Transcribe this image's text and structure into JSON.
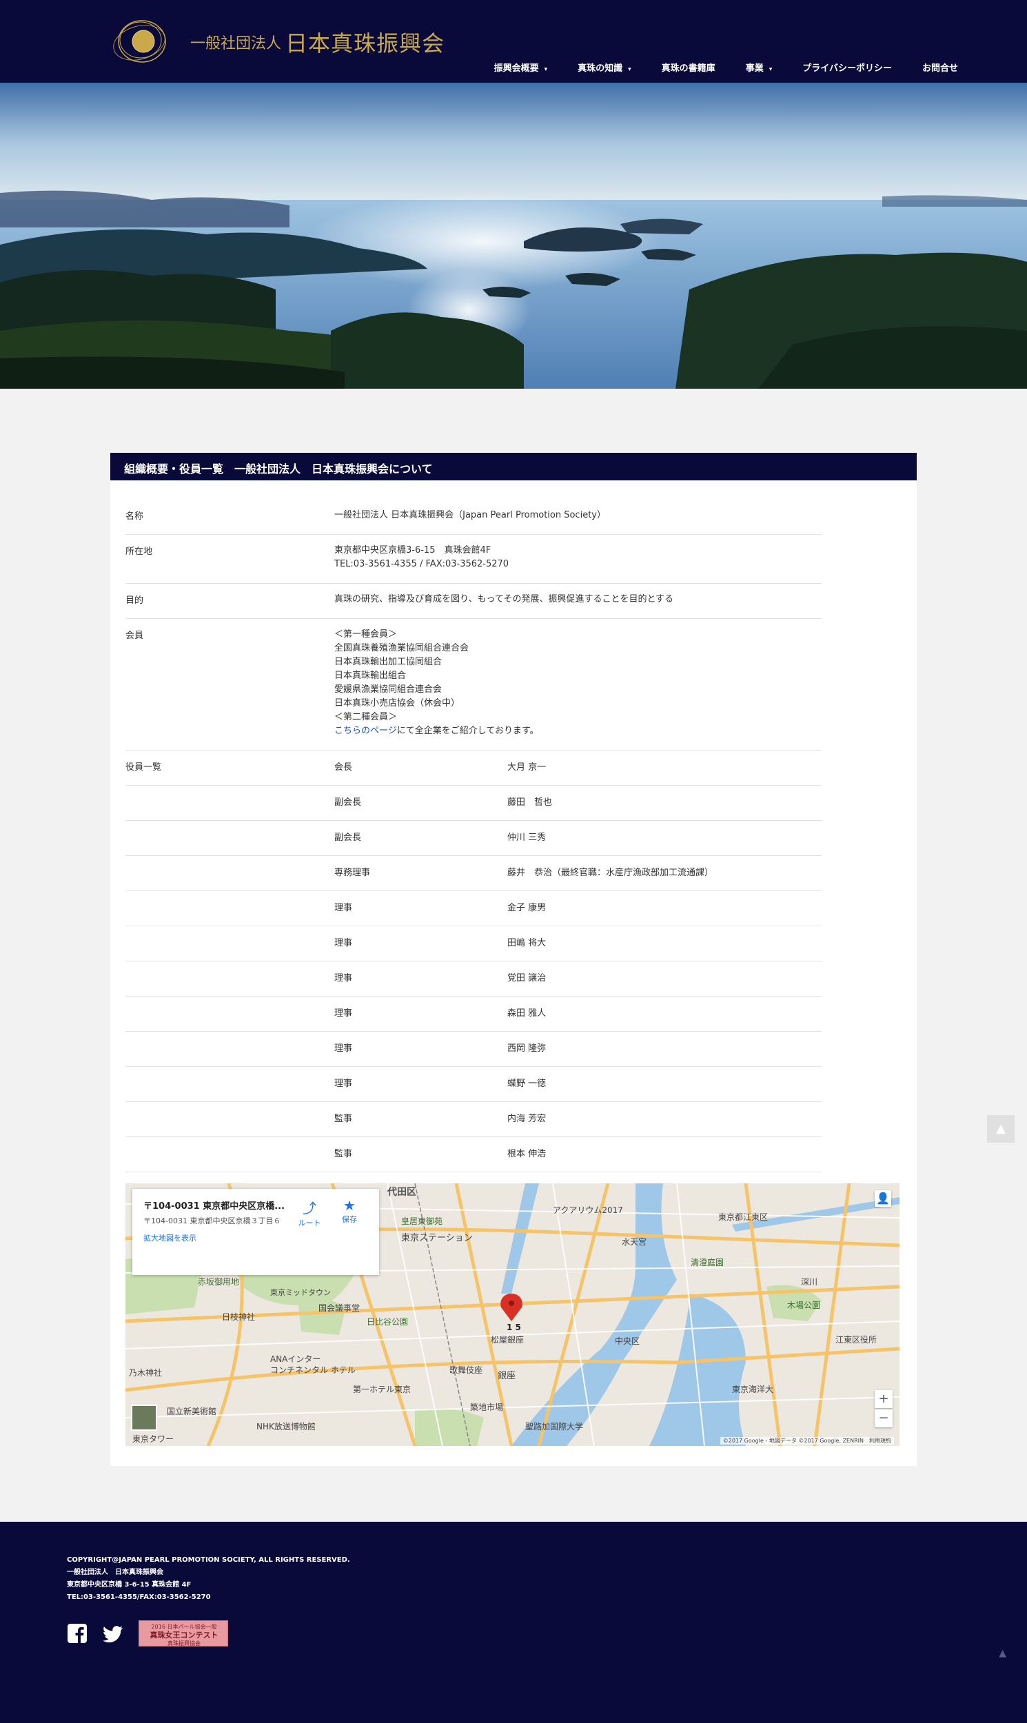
{
  "header": {
    "logo_small": "一般社団法人",
    "logo_big": "日本真珠振興会",
    "nav": [
      {
        "label": "振興会概要"
      },
      {
        "label": "真珠の知識"
      },
      {
        "label": "真珠の書籍庫"
      },
      {
        "label": "事業"
      },
      {
        "label": "プライバシーポリシー"
      },
      {
        "label": "お問合せ"
      }
    ],
    "caret": "▼"
  },
  "section": {
    "title": "組織概要・役員一覧　一般社団法人　日本真珠振興会について"
  },
  "info": {
    "name_label": "名称",
    "name_value": "一般社団法人 日本真珠振興会（Japan Pearl Promotion Society）",
    "address_label": "所在地",
    "address_line1": "東京都中央区京橋3-6-15　真珠会館4F",
    "address_line2": "TEL:03-3561-4355 / FAX:03-3562-5270",
    "purpose_label": "目的",
    "purpose_value": "真珠の研究、指導及び育成を図り、もってその発展、振興促進することを目的とする",
    "members_label": "会員",
    "members": [
      "＜第一種会員＞",
      "全国真珠養殖漁業協同組合連合会",
      "日本真珠輸出加工協同組合",
      "日本真珠輸出組合",
      "愛媛県漁業協同組合連合会",
      "日本真珠小売店協会（休会中）",
      "＜第二種会員＞"
    ],
    "members_link": "こちらのページ",
    "members_link_suffix": "にて全企業をご紹介しております。",
    "officers_label": "役員一覧",
    "officers": [
      {
        "role": "会長",
        "name": "大月 京一"
      },
      {
        "role": "副会長",
        "name": "藤田　哲也"
      },
      {
        "role": "副会長",
        "name": "仲川 三秀"
      },
      {
        "role": "専務理事",
        "name": "藤井　恭治（最終官職：水産庁漁政部加工流通課）"
      },
      {
        "role": "理事",
        "name": "金子 康男"
      },
      {
        "role": "理事",
        "name": "田嶋 将大"
      },
      {
        "role": "理事",
        "name": "覚田 譲治"
      },
      {
        "role": "理事",
        "name": "森田 雅人"
      },
      {
        "role": "理事",
        "name": "西岡 隆弥"
      },
      {
        "role": "理事",
        "name": "蝶野 一徳"
      },
      {
        "role": "監事",
        "name": "内海 芳宏"
      },
      {
        "role": "監事",
        "name": "根本 伸浩"
      }
    ]
  },
  "map": {
    "card_title": "〒104-0031 東京都中央区京橋...",
    "card_address": "〒104-0031 東京都中央区京橋３丁目６",
    "card_link": "拡大地図を表示",
    "route_label": "ルート",
    "save_label": "保存",
    "zoom_in": "+",
    "zoom_out": "−",
    "footer": "©2017 Google - 地図データ ©2017 Google, ZENRIN　利用規約",
    "labels": [
      "代田区",
      "皇居東御苑",
      "東京ステーション",
      "日比谷公園",
      "国会議事堂",
      "日枝神社",
      "赤坂御用地",
      "乃木神社",
      "国立新美術館",
      "NHK放送博物館",
      "東京タワー",
      "築地市場",
      "聖路加国際大学",
      "中央区",
      "東京ミッドタウン",
      "銀座",
      "松屋銀座",
      "歌舞伎座",
      "木場公園",
      "深川",
      "アクアリウム2017",
      "東京都江東区",
      "東京海洋大",
      "水天宮",
      "清澄庭園",
      "江東区役所",
      "1 5",
      "第一ホテル東京",
      "コンチネンタル ホテル",
      "ANAインター"
    ],
    "colors": {
      "water": "#9fc8e8",
      "land": "#ece7df",
      "road": "#f5c46a",
      "park": "#c9dfb0",
      "pin": "#d93025"
    }
  },
  "footer": {
    "copyright": "COPYRIGHT@JAPAN PEARL PROMOTION SOCIETY, ALL RIGHTS RESERVED.",
    "org": "一般社団法人　日本真珠振興会",
    "address": "東京都中央区京橋 3-6-15 真珠会館 4F",
    "tel": "TEL:03-3561-4355/FAX:03-3562-5270",
    "banner_line1": "2016 日本パール協会一般",
    "banner_line2": "真珠女王コンテスト",
    "banner_line3": "真珠振興協会"
  },
  "theme": {
    "navy": "#0a0a3a",
    "gold": "#c9a94a",
    "link": "#1a55b8"
  }
}
